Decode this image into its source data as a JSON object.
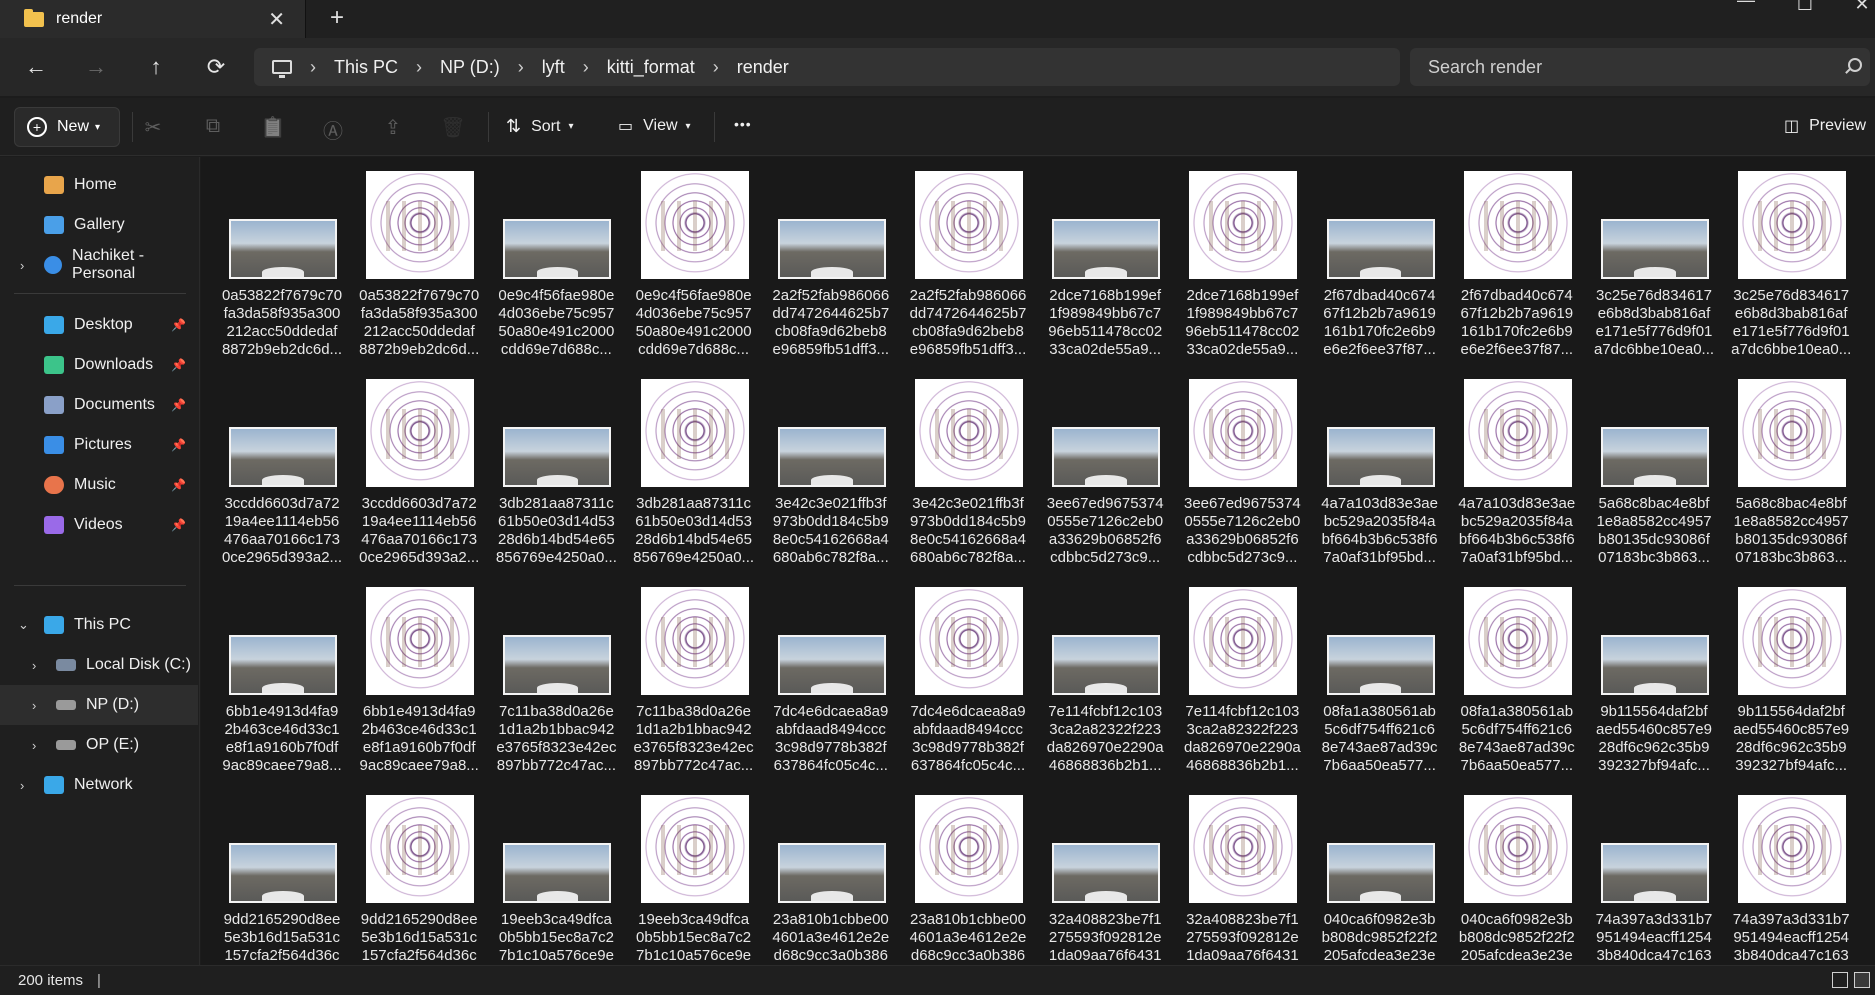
{
  "window": {
    "tab_title": "render",
    "close_symbol": "✕",
    "new_tab_symbol": "+",
    "minimize_symbol": "—",
    "maximize_symbol": "☐",
    "close_window_symbol": "✕"
  },
  "nav": {
    "back_symbol": "←",
    "forward_symbol": "→",
    "up_symbol": "↑",
    "refresh_symbol": "⟳"
  },
  "breadcrumb": [
    "This PC",
    "NP (D:)",
    "lyft",
    "kitti_format",
    "render"
  ],
  "breadcrumb_sep": "›",
  "search": {
    "placeholder": "Search render"
  },
  "toolbar": {
    "new_label": "New",
    "sort_label": "Sort",
    "view_label": "View",
    "more_symbol": "•••",
    "preview_label": "Preview",
    "cut_symbol": "✂",
    "copy_symbol": "⧉",
    "paste_symbol": "📋",
    "rename_symbol": "Ⓐ",
    "share_symbol": "⇪",
    "delete_symbol": "🗑"
  },
  "sidebar": {
    "top": [
      {
        "label": "Home",
        "icon": "home-icon",
        "color": "#e8a54b"
      },
      {
        "label": "Gallery",
        "icon": "gallery-icon",
        "color": "#4a9fe8"
      },
      {
        "label": "Nachiket - Personal",
        "icon": "onedrive-icon",
        "color": "#3a8ee6"
      }
    ],
    "quick": [
      {
        "label": "Desktop",
        "icon": "desktop-icon",
        "color": "#3aa8e8"
      },
      {
        "label": "Downloads",
        "icon": "downloads-icon",
        "color": "#3cc48a"
      },
      {
        "label": "Documents",
        "icon": "documents-icon",
        "color": "#8aa0c8"
      },
      {
        "label": "Pictures",
        "icon": "pictures-icon",
        "color": "#3a8ee6"
      },
      {
        "label": "Music",
        "icon": "music-icon",
        "color": "#e8744b"
      },
      {
        "label": "Videos",
        "icon": "videos-icon",
        "color": "#9a6ae8"
      }
    ],
    "pin_symbol": "📌",
    "drives": [
      {
        "label": "This PC",
        "icon": "this-pc-icon",
        "color": "#3aa8e8"
      },
      {
        "label": "Local Disk (C:)",
        "icon": "local-disk-icon",
        "color": "#7a8aa0"
      },
      {
        "label": "NP (D:)",
        "icon": "drive-icon",
        "color": "#9a9a9a"
      },
      {
        "label": "OP (E:)",
        "icon": "drive-icon",
        "color": "#9a9a9a"
      },
      {
        "label": "Network",
        "icon": "network-icon",
        "color": "#3aa8e8"
      }
    ]
  },
  "files": [
    [
      "0a53822f7679c70",
      "fa3da58f935a300",
      "212acc50ddedaf",
      "8872b9eb2dc6d..."
    ],
    [
      "0a53822f7679c70",
      "fa3da58f935a300",
      "212acc50ddedaf",
      "8872b9eb2dc6d..."
    ],
    [
      "0e9c4f56fae980e",
      "4d036ebe75c957",
      "50a80e491c2000",
      "cdd69e7d688c..."
    ],
    [
      "0e9c4f56fae980e",
      "4d036ebe75c957",
      "50a80e491c2000",
      "cdd69e7d688c..."
    ],
    [
      "2a2f52fab986066",
      "dd7472644625b7",
      "cb08fa9d62beb8",
      "e96859fb51dff3..."
    ],
    [
      "2a2f52fab986066",
      "dd7472644625b7",
      "cb08fa9d62beb8",
      "e96859fb51dff3..."
    ],
    [
      "2dce7168b199ef",
      "1f989849bb67c7",
      "96eb511478cc02",
      "33ca02de55a9..."
    ],
    [
      "2dce7168b199ef",
      "1f989849bb67c7",
      "96eb511478cc02",
      "33ca02de55a9..."
    ],
    [
      "2f67dbad40c674",
      "67f12b2b7a9619",
      "161b170fc2e6b9",
      "e6e2f6ee37f87..."
    ],
    [
      "2f67dbad40c674",
      "67f12b2b7a9619",
      "161b170fc2e6b9",
      "e6e2f6ee37f87..."
    ],
    [
      "3c25e76d834617",
      "e6b8d3bab816af",
      "e171e5f776d9f01",
      "a7dc6bbe10ea0..."
    ],
    [
      "3c25e76d834617",
      "e6b8d3bab816af",
      "e171e5f776d9f01",
      "a7dc6bbe10ea0..."
    ],
    [
      "3ccdd6603d7a72",
      "19a4ee1114eb56",
      "476aa70166c173",
      "0ce2965d393a2..."
    ],
    [
      "3ccdd6603d7a72",
      "19a4ee1114eb56",
      "476aa70166c173",
      "0ce2965d393a2..."
    ],
    [
      "3db281aa87311c",
      "61b50e03d14d53",
      "28d6b14bd54e65",
      "856769e4250a0..."
    ],
    [
      "3db281aa87311c",
      "61b50e03d14d53",
      "28d6b14bd54e65",
      "856769e4250a0..."
    ],
    [
      "3e42c3e021ffb3f",
      "973b0dd184c5b9",
      "8e0c54162668a4",
      "680ab6c782f8a..."
    ],
    [
      "3e42c3e021ffb3f",
      "973b0dd184c5b9",
      "8e0c54162668a4",
      "680ab6c782f8a..."
    ],
    [
      "3ee67ed9675374",
      "0555e7126c2eb0",
      "a33629b06852f6",
      "cdbbc5d273c9..."
    ],
    [
      "3ee67ed9675374",
      "0555e7126c2eb0",
      "a33629b06852f6",
      "cdbbc5d273c9..."
    ],
    [
      "4a7a103d83e3ae",
      "bc529a2035f84a",
      "bf664b3b6c538f6",
      "7a0af31bf95bd..."
    ],
    [
      "4a7a103d83e3ae",
      "bc529a2035f84a",
      "bf664b3b6c538f6",
      "7a0af31bf95bd..."
    ],
    [
      "5a68c8bac4e8bf",
      "1e8a8582cc4957",
      "b80135dc93086f",
      "07183bc3b863..."
    ],
    [
      "5a68c8bac4e8bf",
      "1e8a8582cc4957",
      "b80135dc93086f",
      "07183bc3b863..."
    ],
    [
      "6bb1e4913d4fa9",
      "2b463ce46d33c1",
      "e8f1a9160b7f0df",
      "9ac89caee79a8..."
    ],
    [
      "6bb1e4913d4fa9",
      "2b463ce46d33c1",
      "e8f1a9160b7f0df",
      "9ac89caee79a8..."
    ],
    [
      "7c11ba38d0a26e",
      "1d1a2b1bbac942",
      "e3765f8323e42ec",
      "897bb772c47ac..."
    ],
    [
      "7c11ba38d0a26e",
      "1d1a2b1bbac942",
      "e3765f8323e42ec",
      "897bb772c47ac..."
    ],
    [
      "7dc4e6dcaea8a9",
      "abfdaad8494ccc",
      "3c98d9778b382f",
      "637864fc05c4c..."
    ],
    [
      "7dc4e6dcaea8a9",
      "abfdaad8494ccc",
      "3c98d9778b382f",
      "637864fc05c4c..."
    ],
    [
      "7e114fcbf12c103",
      "3ca2a82322f223",
      "da826970e2290a",
      "46868836b2b1..."
    ],
    [
      "7e114fcbf12c103",
      "3ca2a82322f223",
      "da826970e2290a",
      "46868836b2b1..."
    ],
    [
      "08fa1a380561ab",
      "5c6df754ff621c6",
      "8e743ae87ad39c",
      "7b6aa50ea577..."
    ],
    [
      "08fa1a380561ab",
      "5c6df754ff621c6",
      "8e743ae87ad39c",
      "7b6aa50ea577..."
    ],
    [
      "9b115564daf2bf",
      "aed55460c857e9",
      "28df6c962c35b9",
      "392327bf94afc..."
    ],
    [
      "9b115564daf2bf",
      "aed55460c857e9",
      "28df6c962c35b9",
      "392327bf94afc..."
    ],
    [
      "9dd2165290d8ee",
      "5e3b16d15a531c",
      "157cfa2f564d36c",
      ""
    ],
    [
      "9dd2165290d8ee",
      "5e3b16d15a531c",
      "157cfa2f564d36c",
      ""
    ],
    [
      "19eeb3ca49dfca",
      "0b5bb15ec8a7c2",
      "7b1c10a576ce9e",
      ""
    ],
    [
      "19eeb3ca49dfca",
      "0b5bb15ec8a7c2",
      "7b1c10a576ce9e",
      ""
    ],
    [
      "23a810b1cbbe00",
      "4601a3e4612e2e",
      "d68c9cc3a0b386",
      ""
    ],
    [
      "23a810b1cbbe00",
      "4601a3e4612e2e",
      "d68c9cc3a0b386",
      ""
    ],
    [
      "32a408823be7f1",
      "275593f092812e",
      "1da09aa76f6431",
      ""
    ],
    [
      "32a408823be7f1",
      "275593f092812e",
      "1da09aa76f6431",
      ""
    ],
    [
      "040ca6f0982e3b",
      "b808dc9852f22f2",
      "205afcdea3e23e",
      ""
    ],
    [
      "040ca6f0982e3b",
      "b808dc9852f22f2",
      "205afcdea3e23e",
      ""
    ],
    [
      "74a397a3d331b7",
      "951494eacff1254",
      "3b840dca47c163",
      ""
    ],
    [
      "74a397a3d331b7",
      "951494eacff1254",
      "3b840dca47c163",
      ""
    ]
  ],
  "status": {
    "item_count": "200 items",
    "separator": "|"
  }
}
